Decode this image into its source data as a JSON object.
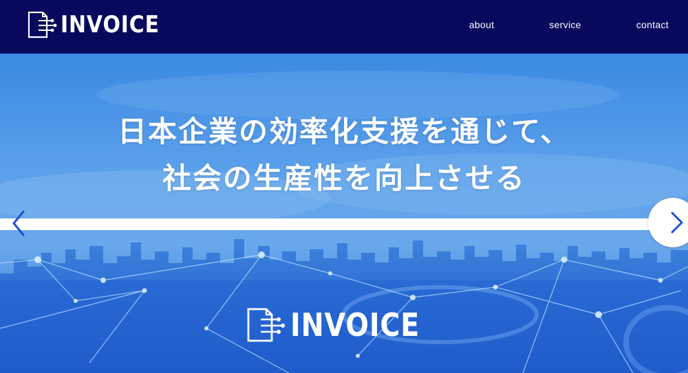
{
  "header": {
    "logo_text": "INVOICE",
    "nav": [
      {
        "label": "about"
      },
      {
        "label": "service"
      },
      {
        "label": "contact"
      }
    ]
  },
  "hero": {
    "headline_line1": "日本企業の効率化支援を通じて、",
    "headline_line2": "社会の生産性を向上させる",
    "logo_text": "INVOICE"
  },
  "icons": {
    "prev": "chevron-left-icon",
    "next": "chevron-right-icon",
    "logo": "document-circuit-icon"
  },
  "colors": {
    "header_bg": "#070a5c",
    "sky_top": "#3f8fe6",
    "sky_mid": "#68a9ec",
    "city": "#1f5fcf",
    "arrow": "#1b4fd6"
  }
}
